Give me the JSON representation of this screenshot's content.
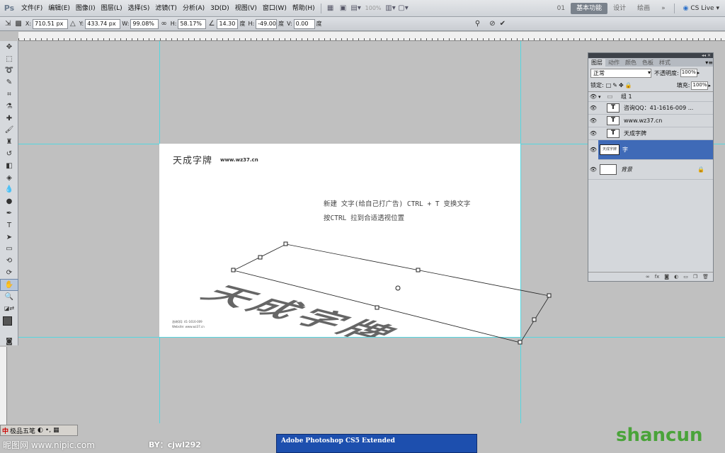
{
  "app": {
    "logo": "Ps"
  },
  "menubar": {
    "items": [
      "文件(F)",
      "编辑(E)",
      "图像(I)",
      "图层(L)",
      "选择(S)",
      "滤镜(T)",
      "分析(A)",
      "3D(D)",
      "视图(V)",
      "窗口(W)",
      "帮助(H)"
    ],
    "zoom_level": "100%",
    "workspace_num": "01",
    "workspaces": [
      "基本功能",
      "设计",
      "绘画"
    ],
    "active_workspace": "基本功能",
    "more": "»",
    "cs_live": "CS Live"
  },
  "options": {
    "x_label": "X:",
    "x_value": "710.51 px",
    "y_label": "Y:",
    "y_value": "433.74 px",
    "w_label": "W:",
    "w_value": "99.08%",
    "h_label": "H:",
    "h_value": "58.17%",
    "angle_value": "14.30",
    "angle_unit": "度",
    "hskew_label": "H:",
    "hskew_value": "-49.00",
    "hskew_unit": "度",
    "vskew_label": "V:",
    "vskew_value": "0.00",
    "vskew_unit": "度",
    "cancel_icon": "cancel-icon",
    "commit_icon": "commit-icon"
  },
  "canvas": {
    "title": "天成字牌",
    "url": "www.wz37.cn",
    "instruction_1": "新建 文字(给自己打广告) CTRL + T 变换文字",
    "instruction_2": "按CTRL 拉到合适透视位置",
    "perspective_text": "天成字牌",
    "footer_line1": "咨询QQ: 41-1616-009",
    "footer_line2": "Website: www.wz37.cn"
  },
  "layers_panel": {
    "tabs": [
      "图层",
      "动作",
      "颜色",
      "色板",
      "样式"
    ],
    "active_tab": "图层",
    "blend_mode": "正常",
    "opacity_label": "不透明度:",
    "opacity_value": "100%",
    "lock_label": "锁定:",
    "fill_label": "填充:",
    "fill_value": "100%",
    "layers": [
      {
        "name": "组 1",
        "type": "group",
        "visible": true
      },
      {
        "name": "咨询QQ：41-1616-009 ...",
        "type": "text",
        "visible": true
      },
      {
        "name": "www.wz37.cn",
        "type": "text",
        "visible": true
      },
      {
        "name": "天成字牌",
        "type": "text",
        "visible": true
      },
      {
        "name": "字",
        "type": "raster",
        "visible": true,
        "selected": true
      },
      {
        "name": "背景",
        "type": "background",
        "visible": true,
        "locked": true
      }
    ]
  },
  "status": {
    "ime": "极品五笔",
    "watermark_left": "昵图网 www.nipic.com",
    "watermark_by": "BY：cjwl292",
    "watermark_right": "shancun",
    "taskbar_item": "Adobe Photoshop CS5 Extended"
  }
}
